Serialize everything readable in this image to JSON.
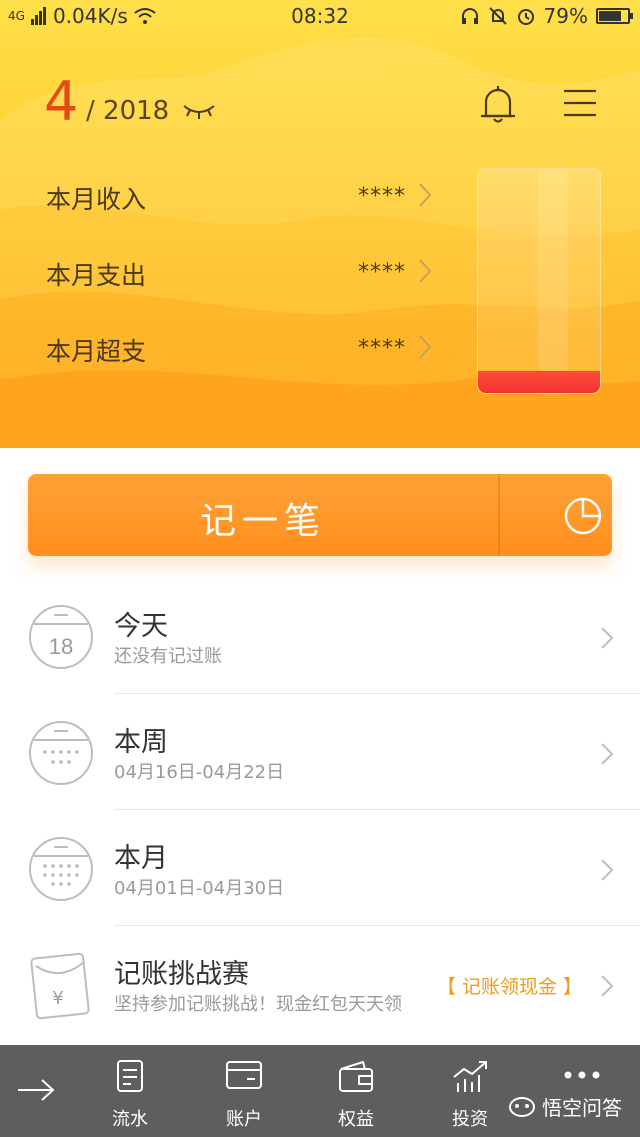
{
  "status_bar": {
    "network": "4G",
    "speed": "0.04K/s",
    "time": "08:32",
    "battery_text": "79%",
    "battery_level": 0.79
  },
  "header": {
    "month": "4",
    "year": "/ 2018"
  },
  "stats": [
    {
      "label": "本月收入",
      "value": "****"
    },
    {
      "label": "本月支出",
      "value": "****"
    },
    {
      "label": "本月超支",
      "value": "****"
    }
  ],
  "record_button": {
    "label": "记一笔"
  },
  "list": [
    {
      "title": "今天",
      "subtitle": "还没有记过账",
      "date_badge": "18"
    },
    {
      "title": "本周",
      "subtitle": "04月16日-04月22日"
    },
    {
      "title": "本月",
      "subtitle": "04月01日-04月30日"
    },
    {
      "title": "记账挑战赛",
      "subtitle": "坚持参加记账挑战！现金红包天天领",
      "promo": "【 记账领现金 】"
    }
  ],
  "nav": [
    {
      "label": "",
      "icon": "arrow-right-icon"
    },
    {
      "label": "流水",
      "icon": "note-icon"
    },
    {
      "label": "账户",
      "icon": "card-icon"
    },
    {
      "label": "权益",
      "icon": "wallet-icon"
    },
    {
      "label": "投资",
      "icon": "chart-icon"
    },
    {
      "label": "",
      "icon": "more-icon"
    }
  ],
  "watermark": "悟空问答",
  "colors": {
    "accent_orange": "#ff9a24",
    "month_red": "#e34a19",
    "nav_bg": "#5e5e5e",
    "promo_orange": "#f39a1e"
  }
}
